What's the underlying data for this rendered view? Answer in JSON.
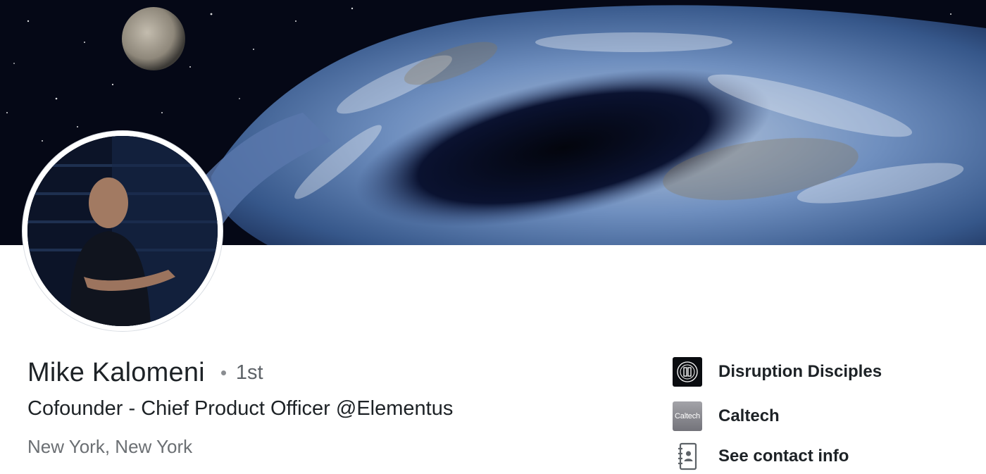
{
  "profile": {
    "name": "Mike Kalomeni",
    "connection_degree": "1st",
    "headline": "Cofounder - Chief Product Officer @Elementus",
    "location": "New York, New York"
  },
  "side_links": [
    {
      "label": "Disruption Disciples",
      "icon": "disruption-disciples-logo"
    },
    {
      "label": "Caltech",
      "icon": "caltech-logo",
      "logo_text": "Caltech"
    },
    {
      "label": "See contact info",
      "icon": "address-book-icon"
    }
  ],
  "colors": {
    "text_primary": "#1d2226",
    "text_secondary": "#6b6f73",
    "banner_space": "#060a1c",
    "earth_blue": "#4a6fa5"
  }
}
